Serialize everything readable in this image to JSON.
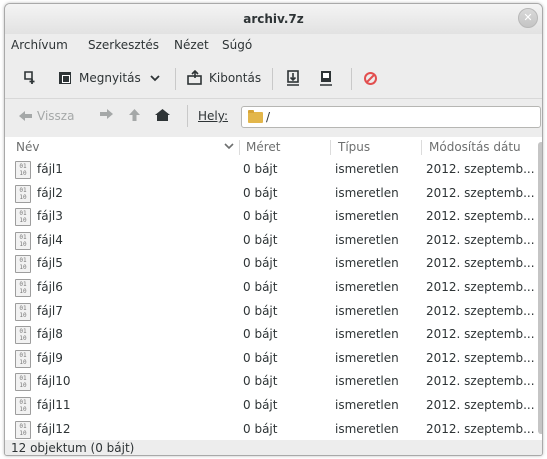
{
  "window": {
    "title": "archiv.7z",
    "close_glyph": "✕"
  },
  "menubar": {
    "items": [
      "Archívum",
      "Szerkesztés",
      "Nézet",
      "Súgó"
    ]
  },
  "toolbar": {
    "open_label": "Megnyitás",
    "extract_label": "Kibontás"
  },
  "location": {
    "back_label": "Vissza",
    "place_label": "Hely:",
    "path": "/"
  },
  "columns": [
    "Név",
    "Méret",
    "Típus",
    "Módosítás dátu"
  ],
  "files": [
    {
      "name": "fájl1",
      "size": "0 bájt",
      "type": "ismeretlen",
      "modified": "2012. szeptemb..."
    },
    {
      "name": "fájl2",
      "size": "0 bájt",
      "type": "ismeretlen",
      "modified": "2012. szeptemb..."
    },
    {
      "name": "fájl3",
      "size": "0 bájt",
      "type": "ismeretlen",
      "modified": "2012. szeptemb..."
    },
    {
      "name": "fájl4",
      "size": "0 bájt",
      "type": "ismeretlen",
      "modified": "2012. szeptemb..."
    },
    {
      "name": "fájl5",
      "size": "0 bájt",
      "type": "ismeretlen",
      "modified": "2012. szeptemb..."
    },
    {
      "name": "fájl6",
      "size": "0 bájt",
      "type": "ismeretlen",
      "modified": "2012. szeptemb..."
    },
    {
      "name": "fájl7",
      "size": "0 bájt",
      "type": "ismeretlen",
      "modified": "2012. szeptemb..."
    },
    {
      "name": "fájl8",
      "size": "0 bájt",
      "type": "ismeretlen",
      "modified": "2012. szeptemb..."
    },
    {
      "name": "fájl9",
      "size": "0 bájt",
      "type": "ismeretlen",
      "modified": "2012. szeptemb..."
    },
    {
      "name": "fájl10",
      "size": "0 bájt",
      "type": "ismeretlen",
      "modified": "2012. szeptemb..."
    },
    {
      "name": "fájl11",
      "size": "0 bájt",
      "type": "ismeretlen",
      "modified": "2012. szeptemb..."
    },
    {
      "name": "fájl12",
      "size": "0 bájt",
      "type": "ismeretlen",
      "modified": "2012. szeptemb..."
    }
  ],
  "status": "12 objektum (0 bájt)"
}
